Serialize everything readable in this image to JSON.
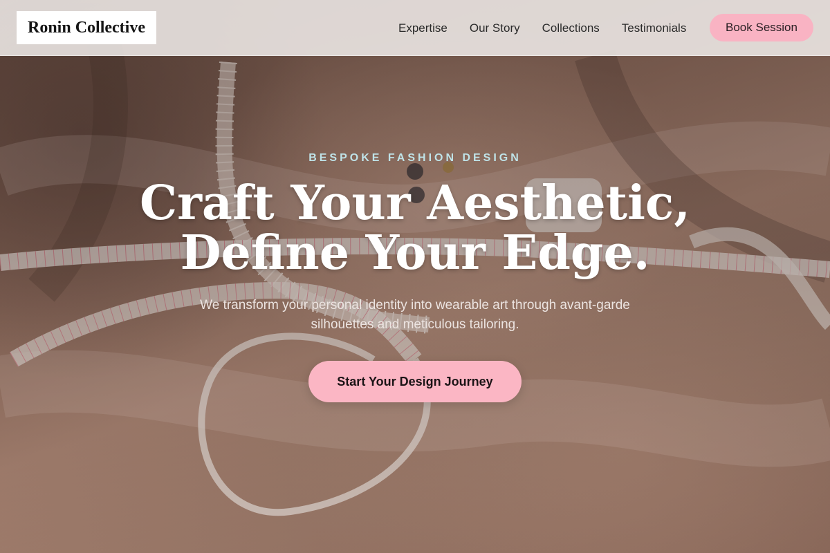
{
  "brand": {
    "name": "Ronin Collective"
  },
  "nav": {
    "links": [
      {
        "label": "Expertise"
      },
      {
        "label": "Our Story"
      },
      {
        "label": "Collections"
      },
      {
        "label": "Testimonials"
      }
    ],
    "cta_label": "Book Session"
  },
  "hero": {
    "eyebrow": "BESPOKE FASHION DESIGN",
    "headline_line1": "Craft Your Aesthetic,",
    "headline_line2": "Define Your Edge.",
    "subtext": "We transform your personal identity into wearable art through avant-garde silhouettes and meticulous tailoring.",
    "cta_label": "Start Your Design Journey",
    "background_image": "measuring-tape-on-fabric"
  },
  "colors": {
    "accent_pink": "#f9b3c3",
    "eyebrow": "#bfe3e8",
    "nav_bg": "#eee9e7"
  }
}
